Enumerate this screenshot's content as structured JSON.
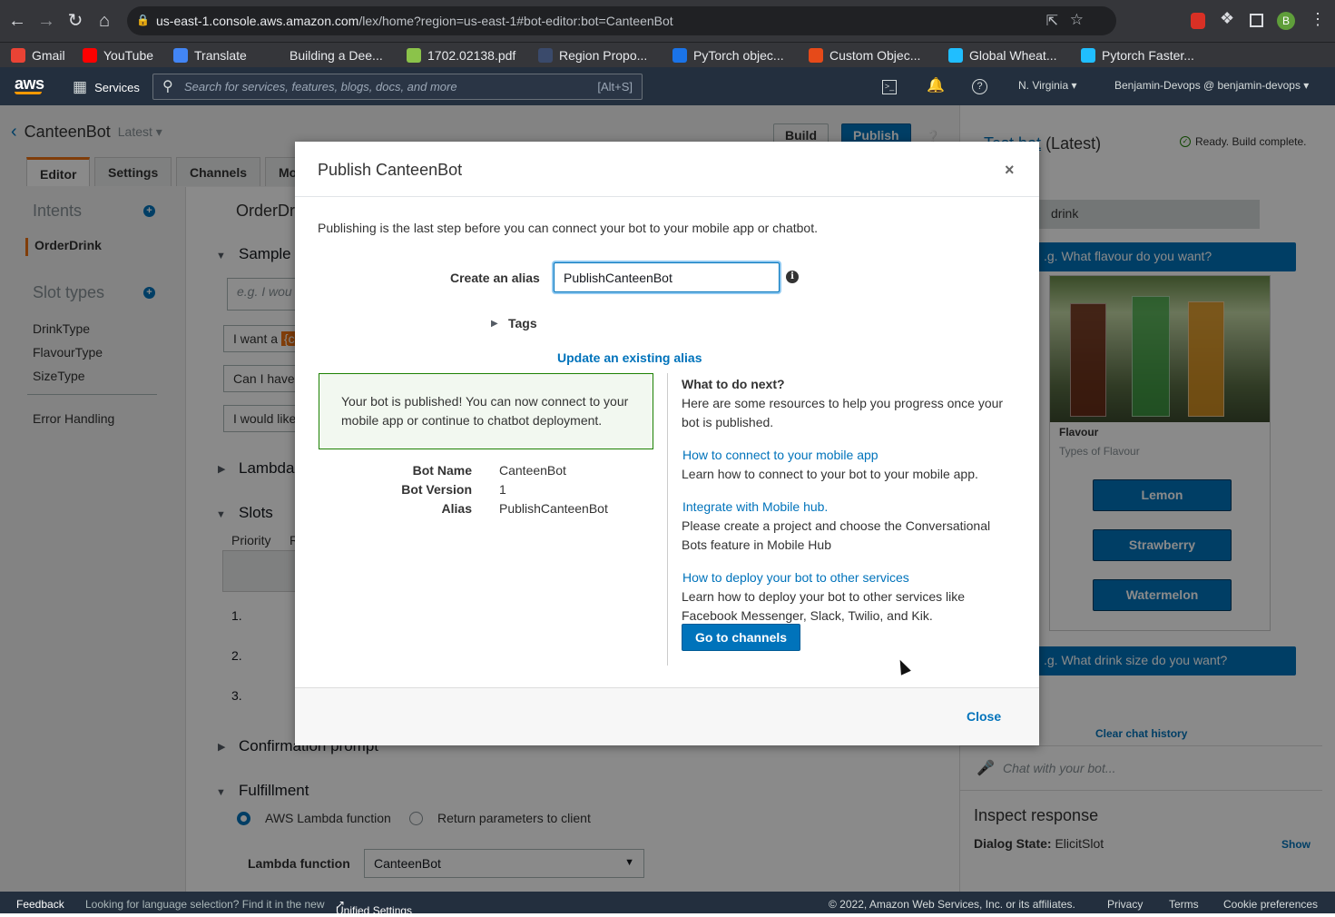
{
  "browser": {
    "url_host": "us-east-1.console.aws.amazon.com",
    "url_path": "/lex/home?region=us-east-1#bot-editor:bot=CanteenBot",
    "profile_initial": "B",
    "bookmarks": [
      {
        "label": "Gmail",
        "icon": "gmail-icon",
        "color": "#ea4335"
      },
      {
        "label": "YouTube",
        "icon": "youtube-icon",
        "color": "#ff0000"
      },
      {
        "label": "Translate",
        "icon": "translate-icon",
        "color": "#4285f4"
      },
      {
        "label": "Building a Dee...",
        "icon": "site-icon",
        "color": "#35363a"
      },
      {
        "label": "1702.02138.pdf",
        "icon": "pdf-icon",
        "color": "#8bc34a"
      },
      {
        "label": "Region Propo...",
        "icon": "tds-icon",
        "color": "#3a4a6b"
      },
      {
        "label": "PyTorch objec...",
        "icon": "pytorch-icon",
        "color": "#1a73e8"
      },
      {
        "label": "Custom Objec...",
        "icon": "custom-icon",
        "color": "#e64a19"
      },
      {
        "label": "Global Wheat...",
        "icon": "kaggle-icon",
        "color": "#20beff"
      },
      {
        "label": "Pytorch Faster...",
        "icon": "kaggle-icon",
        "color": "#20beff"
      }
    ]
  },
  "awsnav": {
    "logo": "aws",
    "services": "Services",
    "search_placeholder": "Search for services, features, blogs, docs, and more",
    "search_shortcut": "[Alt+S]",
    "region": "N. Virginia",
    "user": "Benjamin-Devops @ benjamin-devops"
  },
  "app": {
    "bot_name": "CanteenBot",
    "version_label": "Latest",
    "build": "Build",
    "publish": "Publish",
    "tabs": [
      "Editor",
      "Settings",
      "Channels",
      "Mo"
    ],
    "intents_title": "Intents",
    "intents": [
      "OrderDrink"
    ],
    "slot_types_title": "Slot types",
    "slot_types": [
      "DrinkType",
      "FlavourType",
      "SizeType"
    ],
    "error_handling": "Error Handling",
    "intent_title": "OrderDr",
    "sample_title": "Sample",
    "sample_placeholder": "e.g. I wou",
    "utterances": [
      "I want a",
      "Can I have",
      "I would like"
    ],
    "utterance_slot_chip": "{c",
    "lambda_section": "Lambda",
    "slots_section": "Slots",
    "priority_header": "Priority",
    "priority_col2": "R",
    "priorities": [
      "1.",
      "2.",
      "3."
    ],
    "confirmation": "Confirmation prompt",
    "fulfillment": "Fulfillment",
    "radio_lambda": "AWS Lambda function",
    "radio_return": "Return parameters to client",
    "lambda_label": "Lambda function",
    "lambda_value": "CanteenBot"
  },
  "testbot": {
    "title": "Test bot",
    "title_suffix": "(Latest)",
    "status": "Ready. Build complete.",
    "user_msg": "drink",
    "bot_msg1": ".g. What flavour do you want?",
    "card_title": "Flavour",
    "card_subtitle": "Types of Flavour",
    "options": [
      "Lemon",
      "Strawberry",
      "Watermelon"
    ],
    "bot_msg2": ".g. What drink size do you want?",
    "clear": "Clear chat history",
    "chat_placeholder": "Chat with your bot...",
    "inspect": "Inspect response",
    "dialog_state_label": "Dialog State:",
    "dialog_state_value": "ElicitSlot",
    "show": "Show"
  },
  "modal": {
    "title": "Publish CanteenBot",
    "intro": "Publishing is the last step before you can connect your bot to your mobile app or chatbot.",
    "alias_label": "Create an alias",
    "alias_value": "PublishCanteenBot",
    "tags": "Tags",
    "update_alias": "Update an existing alias",
    "success": "Your bot is published! You can now connect to your mobile app or continue to chatbot deployment.",
    "details": [
      {
        "label": "Bot Name",
        "value": "CanteenBot"
      },
      {
        "label": "Bot Version",
        "value": "1"
      },
      {
        "label": "Alias",
        "value": "PublishCanteenBot"
      }
    ],
    "next_title": "What to do next?",
    "next_intro": "Here are some resources to help you progress once your bot is published.",
    "link1": "How to connect to your mobile app",
    "desc1": "Learn how to connect to your bot to your mobile app.",
    "link2": "Integrate with Mobile hub.",
    "desc2": "Please create a project and choose the Conversational Bots feature in Mobile Hub",
    "link3": "How to deploy your bot to other services",
    "desc3": "Learn how to deploy your bot to other services like Facebook Messenger, Slack, Twilio, and Kik.",
    "go_channels": "Go to channels",
    "close": "Close"
  },
  "footer": {
    "feedback": "Feedback",
    "lang": "Looking for language selection? Find it in the new",
    "unified": "Unified Settings",
    "copyright": "© 2022, Amazon Web Services, Inc. or its affiliates.",
    "privacy": "Privacy",
    "terms": "Terms",
    "cookies": "Cookie preferences"
  }
}
